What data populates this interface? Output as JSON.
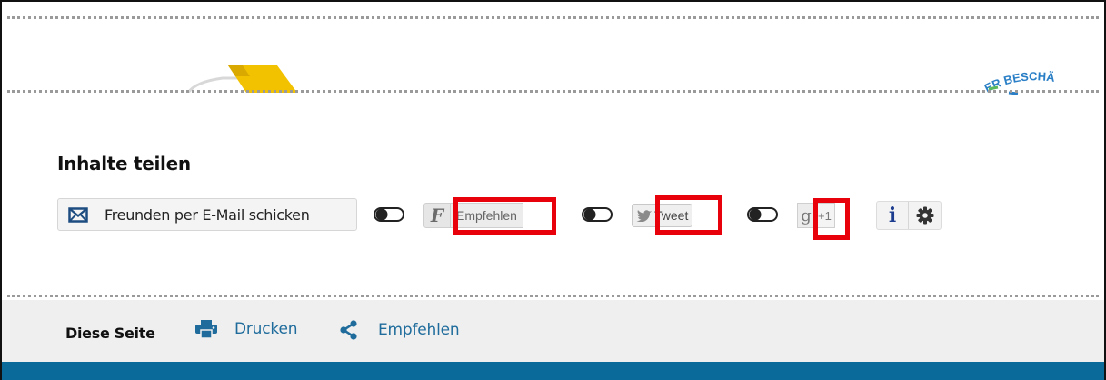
{
  "share_section": {
    "title": "Inhalte teilen",
    "email_button": "Freunden per E-Mail schicken",
    "facebook": {
      "icon_letter": "F",
      "label": "Empfehlen"
    },
    "twitter": {
      "label": "Tweet"
    },
    "googleplus": {
      "icon_letter": "g",
      "label": "+1"
    },
    "info_letter": "i"
  },
  "top_partial": {
    "badge_text": "ER BESCHÄ"
  },
  "footer": {
    "this_page": "Diese Seite",
    "print": "Drucken",
    "share": "Empfehlen"
  },
  "colors": {
    "highlight": "#e8000b",
    "link": "#1f6c9c",
    "bottom_band": "#0a6a99",
    "info_icon": "#1c3d8f"
  }
}
